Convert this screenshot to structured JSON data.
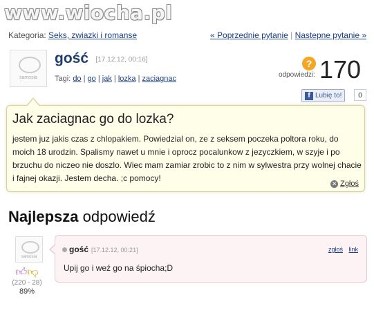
{
  "watermark": "www.wiocha.pl",
  "breadcrumb": {
    "label": "Kategoria:",
    "category": "Seks, zwiazki i romanse",
    "prev": "« Poprzednie pytanie",
    "sep": "|",
    "next": "Nastepne pytanie »"
  },
  "asker": {
    "name": "gość",
    "date": "[17.12.12, 00:16]",
    "avatar_text": "samosia"
  },
  "tags": {
    "label": "Tagi:",
    "items": [
      "do",
      "go",
      "jak",
      "lozka",
      "zaciagnac"
    ]
  },
  "answers": {
    "label": "odpowiedzi:",
    "count": "170",
    "icon": "question-icon"
  },
  "facebook": {
    "like_label": "Lubię to!",
    "like_count": "0"
  },
  "question": {
    "title": "Jak zaciagnac go do lozka?",
    "body": "jestem juz jakis czas z chlopakiem. Powiedzial on, ze z seksem poczeka poltora roku, do moich 18 urodzin. Spalismy nawet u mnie i oprocz pocalunkow z jezyczkiem, w szyje i po brzuchu do niczeo nie doszlo. Wiec mam zamiar zrobic to z nim w sylwestra przy wolnej chacie i fajnej okazji. Jestem decha. ;c pomocy!",
    "report": "Zgłoś"
  },
  "best": {
    "heading_bold": "Najlepsza",
    "heading_rest": "odpowiedź"
  },
  "answer": {
    "name": "gość",
    "date": "[17.12.12, 00:21]",
    "report": "zgłoś",
    "link": "link",
    "text": "Upij go i weź go na śpiocha;D",
    "avatar_text": "samosia"
  },
  "votes": {
    "count": "(220 - 28)",
    "percent": "89%"
  },
  "colors": {
    "link": "#1a3f8c",
    "question_bg": "#fffee8",
    "answer_bg": "#fdf3f4",
    "answers_icon": "#f5a623"
  }
}
